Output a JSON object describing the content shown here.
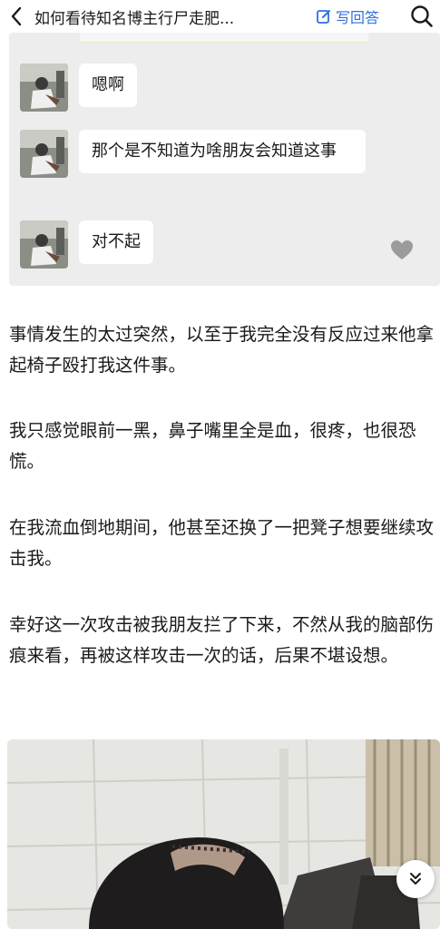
{
  "header": {
    "title": "如何看待知名博主行尸走肥...",
    "write_answer_label": "写回答"
  },
  "chat": {
    "messages": [
      {
        "text": "嗯啊"
      },
      {
        "text": "那个是不知道为啥朋友会知道这事"
      },
      {
        "text": "对不起"
      }
    ]
  },
  "article": {
    "paragraphs": [
      "事情发生的太过突然，以至于我完全没有反应过来他拿起椅子殴打我这件事。",
      "我只感觉眼前一黑，鼻子嘴里全是血，很疼，也很恐慌。",
      "在我流血倒地期间，他甚至还换了一把凳子想要继续攻击我。",
      "幸好这一次攻击被我朋友拦了下来，不然从我的脑部伤痕来看，再被这样攻击一次的话，后果不堪设想。"
    ]
  },
  "colors": {
    "accent": "#2f6fe0",
    "chat_background": "#ededed"
  },
  "icons": [
    "back-arrow-icon",
    "edit-icon",
    "search-icon",
    "heart-icon",
    "double-chevron-down-icon"
  ]
}
